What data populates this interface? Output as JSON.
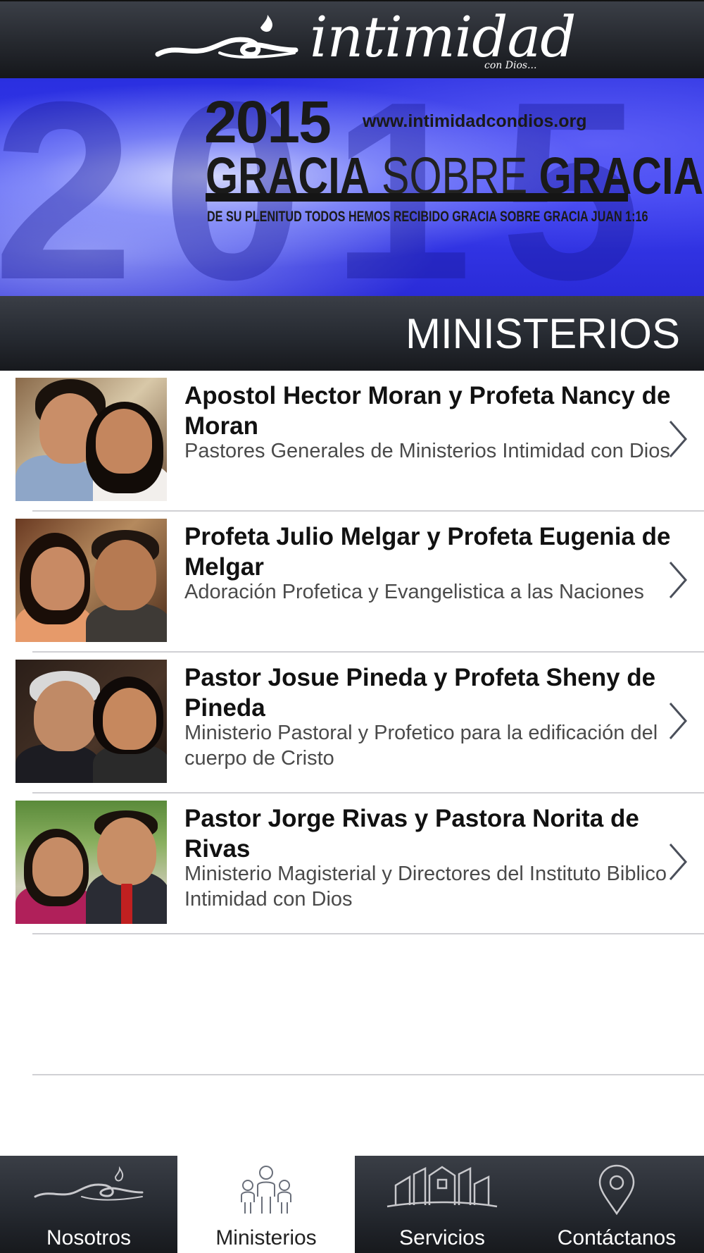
{
  "header": {
    "logo_word": "intimidad",
    "logo_sub": "con Dios..."
  },
  "banner": {
    "ghost": "2015",
    "year": "2015",
    "url": "www.intimidadcondios.org",
    "title_part1": "GRACIA",
    "title_part2": "SOBRE",
    "title_part3": "GRACIA",
    "subtitle": "DE SU PLENITUD TODOS HEMOS RECIBIDO GRACIA SOBRE GRACIA JUAN 1:16"
  },
  "section": {
    "title": "MINISTERIOS"
  },
  "ministries": [
    {
      "title": "Apostol Hector Moran y Profeta Nancy de Moran",
      "subtitle": "Pastores Generales de Ministerios Intimidad con Dios"
    },
    {
      "title": "Profeta Julio Melgar y Profeta Eugenia de Melgar",
      "subtitle": "Adoración Profetica y Evangelistica a las Naciones"
    },
    {
      "title": "Pastor Josue Pineda y Profeta Sheny de Pineda",
      "subtitle": "Ministerio Pastoral y Profetico para la edificación del cuerpo de Cristo"
    },
    {
      "title": "Pastor Jorge Rivas y Pastora Norita de Rivas",
      "subtitle": "Ministerio Magisterial y Directores del Instituto Biblico Intimidad con Dios"
    }
  ],
  "tabs": [
    {
      "label": "Nosotros",
      "icon": "waves-logo-icon",
      "active": false
    },
    {
      "label": "Ministerios",
      "icon": "people-icon",
      "active": true
    },
    {
      "label": "Servicios",
      "icon": "buildings-icon",
      "active": false
    },
    {
      "label": "Contáctanos",
      "icon": "location-pin-icon",
      "active": false
    }
  ],
  "colors": {
    "bar_dark": "#25282e",
    "banner_blue": "#2a2fe0",
    "active_tab": "#ffffff"
  }
}
